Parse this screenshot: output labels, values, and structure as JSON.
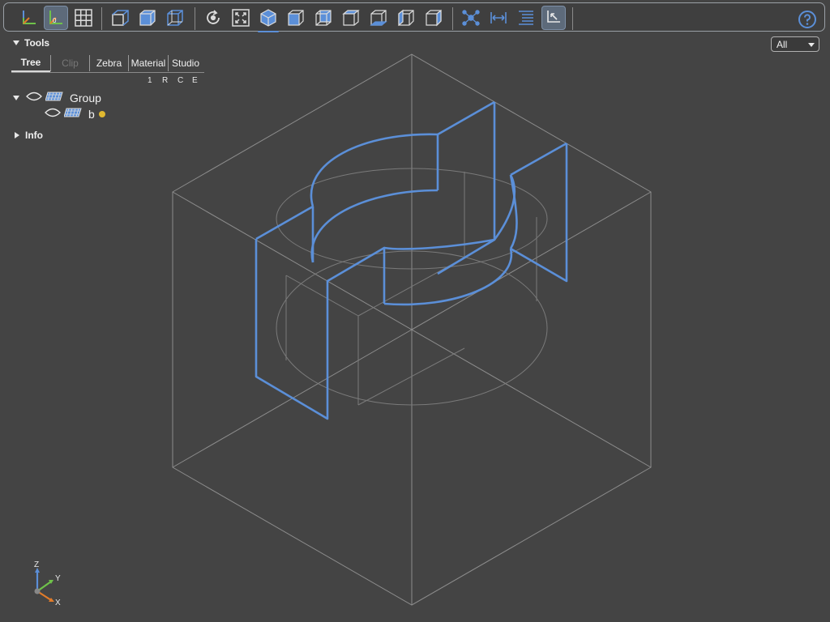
{
  "toolbar": {
    "groups": [
      [
        "axes-icon",
        "axes-origin-icon",
        "grid-icon"
      ],
      [
        "perspective-icon",
        "shaded-box-icon",
        "wireframe-box-icon"
      ],
      [
        "reset-view-icon",
        "fit-view-icon",
        "iso-view-icon",
        "front-view-icon",
        "rear-view-icon",
        "top-view-icon",
        "bottom-view-icon",
        "left-view-icon",
        "right-view-icon"
      ],
      [
        "explode-icon",
        "measure-distance-icon",
        "properties-list-icon",
        "select-pointer-icon"
      ]
    ],
    "active": [
      "axes-origin-icon",
      "select-pointer-icon"
    ],
    "underlined": [
      "iso-view-icon"
    ],
    "help_icon": "help-icon"
  },
  "filter_dropdown": {
    "value": "All"
  },
  "tools_panel": {
    "title": "Tools",
    "tabs": [
      {
        "label": "Tree",
        "state": "active"
      },
      {
        "label": "Clip",
        "state": "disabled"
      },
      {
        "label": "Zebra",
        "state": "normal"
      },
      {
        "label": "Material",
        "state": "normal"
      },
      {
        "label": "Studio",
        "state": "normal"
      }
    ],
    "column_headers": [
      "1",
      "R",
      "C",
      "E"
    ]
  },
  "tree": {
    "group_label": "Group",
    "child_label": "b",
    "child_status_color": "#e0b830"
  },
  "info_section": {
    "label": "Info"
  },
  "triad": {
    "z": "Z",
    "y": "Y",
    "x": "X"
  },
  "colors": {
    "background": "#444444",
    "accent_blue": "#5b8fd8",
    "edge_gray": "#8a8a8a",
    "axis_x": "#e07b2a",
    "axis_y": "#6fc24a",
    "axis_z": "#5b8fd8"
  }
}
